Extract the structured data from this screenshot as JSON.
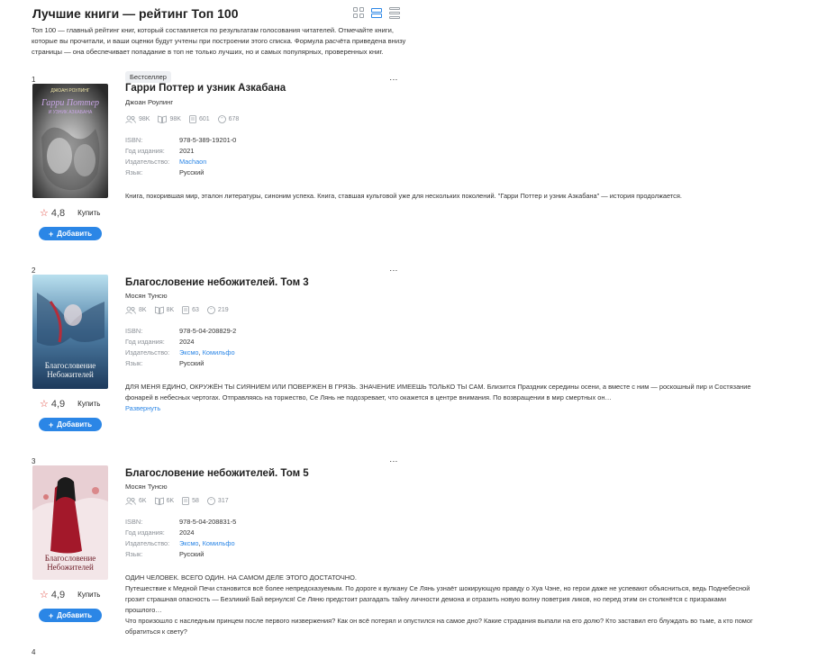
{
  "page": {
    "title": "Лучшие книги — рейтинг Топ 100",
    "intro": "Топ 100 — главный рейтинг книг, который составляется по результатам голосования читателей. Отмечайте книги, которые вы прочитали, и ваши оценки будут учтены при построении этого списка. Формула расчёта приведена внизу страницы — она обеспечивает попадание в топ не только лучших, но и самых популярных, проверенных книг.",
    "view_icons": [
      "grid-view-icon",
      "wide-view-icon",
      "list-view-icon"
    ]
  },
  "labels": {
    "isbn": "ISBN:",
    "year": "Год издания:",
    "publisher": "Издательство:",
    "language": "Язык:",
    "buy": "Купить",
    "add": "Добавить",
    "expand": "Развернуть"
  },
  "books": [
    {
      "rank": "1",
      "badge": "Бестселлер",
      "title": "Гарри Поттер и узник Азкабана",
      "author": "Джоан Роулинг",
      "stats": {
        "readers": "98K",
        "read": "98K",
        "reviews": "601",
        "quotes": "678"
      },
      "isbn": "978-5-389-19201-0",
      "year": "2021",
      "publishers": [
        "Machaon"
      ],
      "language": "Русский",
      "rating": "4,8",
      "description": "Книга, покорившая мир, эталон литературы, синоним успеха. Книга, ставшая культовой уже для нескольких поколений. \"Гарри Поттер и узник Азкабана\" — история продолжается.",
      "cover_text": [
        "ДЖОАН РОУЛИНГ",
        "Гарри Поттер",
        "И УЗНИК АЗКАБАНА"
      ]
    },
    {
      "rank": "2",
      "title": "Благословение небожителей. Том 3",
      "author": "Мосян Тунсю",
      "stats": {
        "readers": "8K",
        "read": "8K",
        "reviews": "63",
        "quotes": "219"
      },
      "isbn": "978-5-04-208829-2",
      "year": "2024",
      "publishers": [
        "Эксмо",
        "Комильфо"
      ],
      "language": "Русский",
      "rating": "4,9",
      "description": "ДЛЯ МЕНЯ ЕДИНО, ОКРУЖЁН ТЫ СИЯНИЕМ ИЛИ ПОВЕРЖЕН В ГРЯЗЬ. ЗНАЧЕНИЕ ИМЕЕШЬ ТОЛЬКО ТЫ САМ. Близится Праздник середины осени, а вместе с ним — роскошный пир и Состязание фонарей в небесных чертогах. Отправляясь на торжество, Се Лянь не подозревает, что окажется в центре внимания. По возвращении в мир смертных он…",
      "cover_text": [
        "Благословение",
        "Небожителей"
      ]
    },
    {
      "rank": "3",
      "title": "Благословение небожителей. Том 5",
      "author": "Мосян Тунсю",
      "stats": {
        "readers": "6K",
        "read": "6K",
        "reviews": "58",
        "quotes": "317"
      },
      "isbn": "978-5-04-208831-5",
      "year": "2024",
      "publishers": [
        "Эксмо",
        "Комильфо"
      ],
      "language": "Русский",
      "rating": "4,9",
      "description": "ОДИН ЧЕЛОВЕК. ВСЕГО ОДИН. НА САМОМ ДЕЛЕ ЭТОГО ДОСТАТОЧНО.\nПутешествие к Медной Печи становится всё более непредсказуемым. По дороге к вулкану Се Лянь узнаёт шокирующую правду о Хуа Чэне, но герои даже не успевают объясниться, ведь Поднебесной грозит страшная опасность — Безликий Бай вернулся! Се Ляню предстоит разгадать тайну личности демона и отразить новую волну поветрия ликов, но перед этим он столкнётся с призраками прошлого…\nЧто произошло с наследным принцем после первого низвержения? Как он всё потерял и опустился на самое дно? Какие страдания выпали на его долю? Кто заставил его блуждать во тьме, а кто помог обратиться к свету?",
      "cover_text": [
        "Благословение",
        "Небожителей"
      ]
    },
    {
      "rank": "4"
    }
  ]
}
